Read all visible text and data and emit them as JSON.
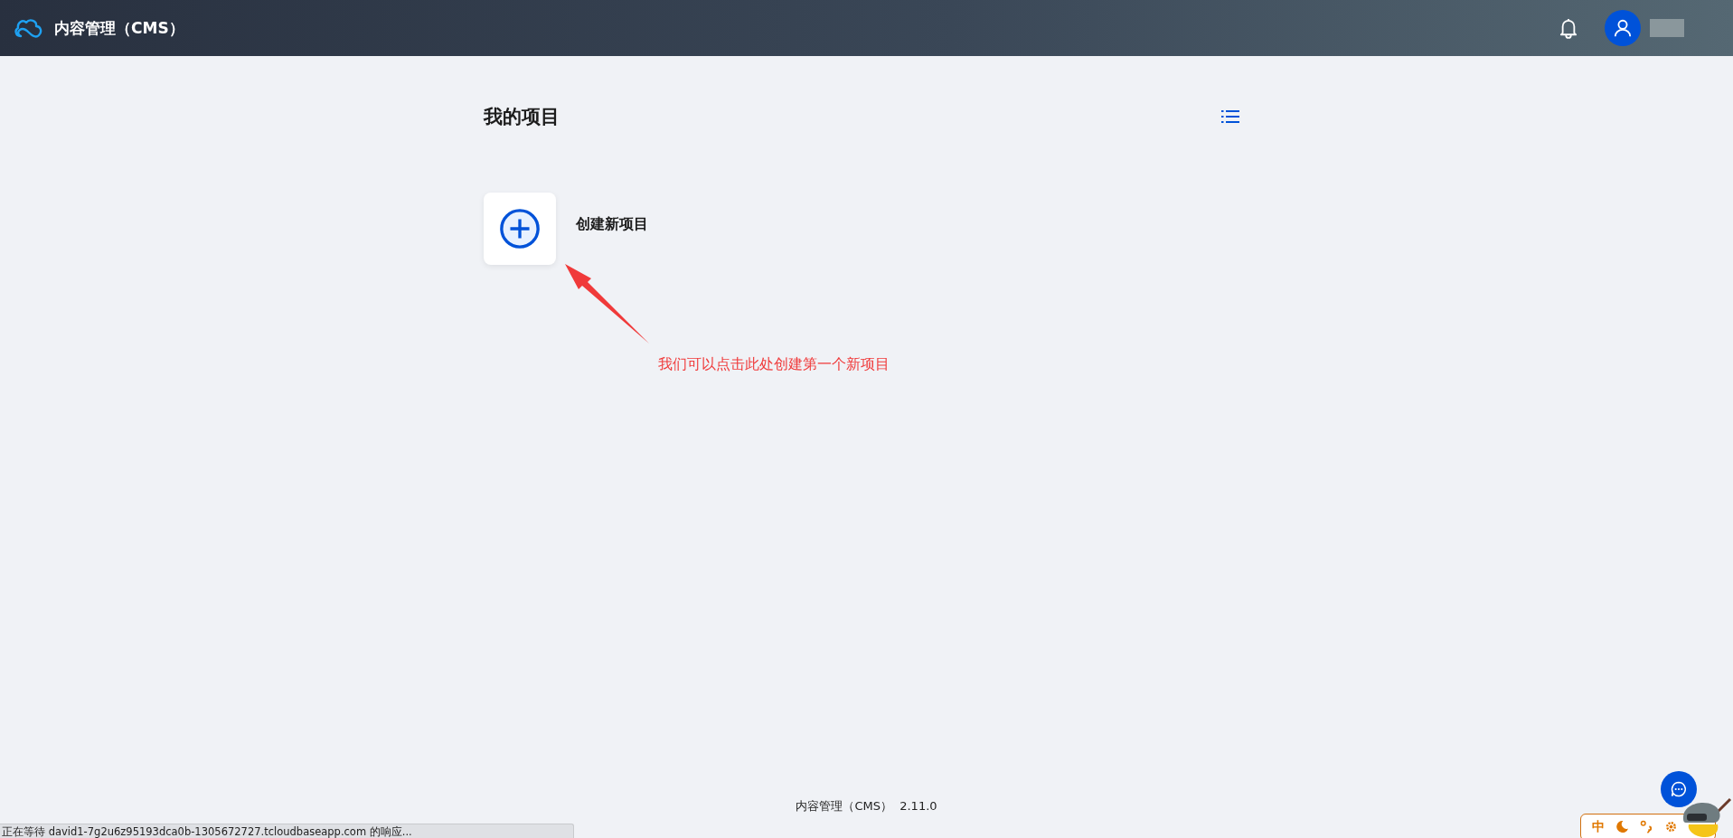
{
  "header": {
    "title": "内容管理（CMS）"
  },
  "page": {
    "title": "我的项目",
    "create_label": "创建新项目"
  },
  "annotation": {
    "text": "我们可以点击此处创建第一个新项目"
  },
  "footer": {
    "product": "内容管理（CMS）",
    "version": "2.11.0"
  },
  "status_bar": {
    "text": "正在等待 david1-7g2u6z95193dca0b-1305672727.tcloudbaseapp.com 的响应..."
  },
  "ime_toolbar": {
    "mode": "中"
  }
}
